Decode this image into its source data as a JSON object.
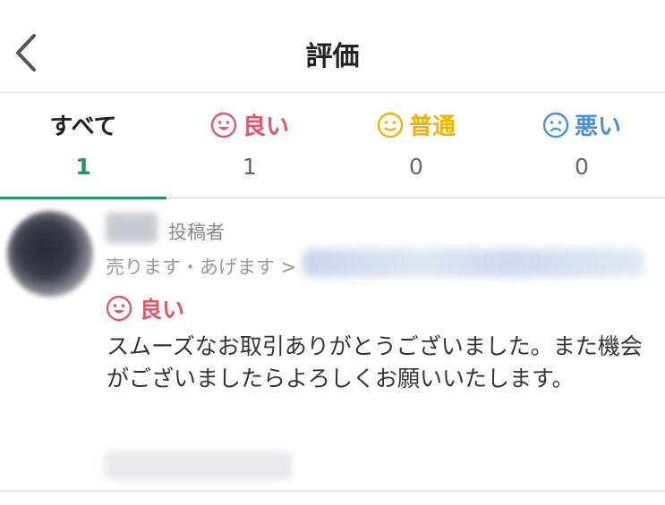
{
  "header": {
    "title": "評価",
    "back_icon": "chevron-left-icon"
  },
  "tabs": [
    {
      "label": "すべて",
      "count": "1",
      "icon": null,
      "color": "#222222",
      "active": true
    },
    {
      "label": "良い",
      "count": "1",
      "icon": "smile-face-icon",
      "color": "#e5546b",
      "active": false
    },
    {
      "label": "普通",
      "count": "0",
      "icon": "neutral-face-icon",
      "color": "#f2b300",
      "active": false
    },
    {
      "label": "悪い",
      "count": "0",
      "icon": "sad-face-icon",
      "color": "#4a90d9",
      "active": false
    }
  ],
  "accent_color": "#1a9c5b",
  "review": {
    "role_label": "投稿者",
    "trade_prefix": "売ります・あげます >",
    "rating_label": "良い",
    "rating_icon": "smile-face-icon",
    "comment": "スムーズなお取引ありがとうございました。また機会がございましたらよろしくお願いいたします。"
  }
}
